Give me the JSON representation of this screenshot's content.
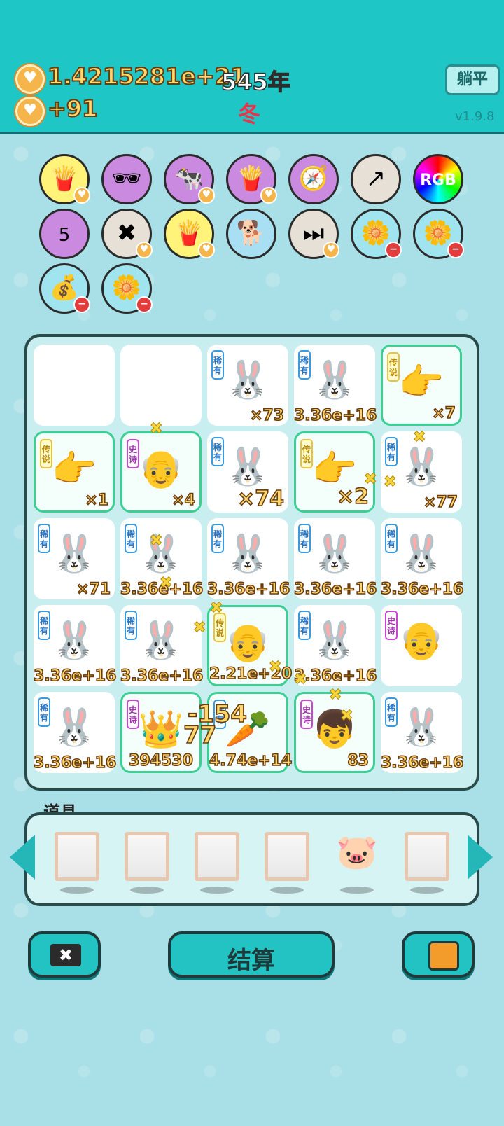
{
  "header": {
    "coins": "1.4215281e+21",
    "income": "+91",
    "year": "545年",
    "season": "冬",
    "lie_ping": "躺平",
    "version": "v1.9.8"
  },
  "buffs": [
    {
      "icon": "fries-icon",
      "glyph": "🍟",
      "bg": "yellow",
      "badge": "heart"
    },
    {
      "icon": "melon-sunglasses-icon",
      "glyph": "🕶",
      "bg": "purple",
      "badge": ""
    },
    {
      "icon": "cow-twins-icon",
      "glyph": "🐄",
      "bg": "purple",
      "badge": "heart"
    },
    {
      "icon": "fries-icon",
      "glyph": "🍟",
      "bg": "purple",
      "badge": "heart"
    },
    {
      "icon": "compass-icon",
      "glyph": "🧭",
      "bg": "purple",
      "badge": ""
    },
    {
      "icon": "chart-arrow-icon",
      "glyph": "↗",
      "bg": "grey",
      "badge": ""
    },
    {
      "icon": "rgb-icon",
      "glyph": "RGB",
      "bg": "rgb",
      "badge": ""
    },
    {
      "icon": "calendar-icon",
      "glyph": "5",
      "bg": "purple",
      "badge": ""
    },
    {
      "icon": "delete-tag-icon",
      "glyph": "✖",
      "bg": "grey",
      "badge": "heart"
    },
    {
      "icon": "fries-icon",
      "glyph": "🍟",
      "bg": "yellow",
      "badge": "heart"
    },
    {
      "icon": "shiba-dog-icon",
      "glyph": "🐕",
      "bg": "blue",
      "badge": ""
    },
    {
      "icon": "skip-icon",
      "glyph": "⏭",
      "bg": "grey",
      "badge": "heart"
    },
    {
      "icon": "flower-pot-icon",
      "glyph": "🌼",
      "bg": "cyan",
      "badge": "minus"
    },
    {
      "icon": "flower-pot-icon",
      "glyph": "🌼",
      "bg": "cyan",
      "badge": "minus"
    },
    {
      "icon": "money-bag-icon",
      "glyph": "💰",
      "bg": "cyan",
      "badge": "minus"
    },
    {
      "icon": "flower-pot-icon",
      "glyph": "🌼",
      "bg": "cyan",
      "badge": "minus"
    }
  ],
  "board": [
    {
      "kind": "empty"
    },
    {
      "kind": "empty"
    },
    {
      "kind": "rare",
      "label": "稀有",
      "sprite": "🐰",
      "count": "×73"
    },
    {
      "kind": "rare",
      "label": "稀有",
      "sprite": "🐰",
      "count": "3.36e+16"
    },
    {
      "kind": "legend",
      "label": "传说",
      "sprite": "👉",
      "count": "×7"
    },
    {
      "kind": "legend",
      "label": "传说",
      "sprite": "👉",
      "count": "×1"
    },
    {
      "kind": "epic",
      "label": "史诗",
      "sprite": "👴",
      "count": "×4"
    },
    {
      "kind": "rare",
      "label": "稀有",
      "sprite": "🐰",
      "count": "×74",
      "big": true
    },
    {
      "kind": "legend",
      "label": "传说",
      "sprite": "👉",
      "count": "×2",
      "big": true
    },
    {
      "kind": "rare",
      "label": "稀有",
      "sprite": "🐰",
      "count": "×77"
    },
    {
      "kind": "rare",
      "label": "稀有",
      "sprite": "🐰",
      "count": "×71"
    },
    {
      "kind": "rare",
      "label": "稀有",
      "sprite": "🐰",
      "count": "3.36e+16"
    },
    {
      "kind": "rare",
      "label": "稀有",
      "sprite": "🐰",
      "count": "3.36e+16"
    },
    {
      "kind": "rare",
      "label": "稀有",
      "sprite": "🐰",
      "count": "3.36e+16"
    },
    {
      "kind": "rare",
      "label": "稀有",
      "sprite": "🐰",
      "count": "3.36e+16"
    },
    {
      "kind": "rare",
      "label": "稀有",
      "sprite": "🐰",
      "count": "3.36e+16"
    },
    {
      "kind": "rare",
      "label": "稀有",
      "sprite": "🐰",
      "count": "3.36e+16"
    },
    {
      "kind": "epic",
      "label": "传说",
      "sprite": "👴",
      "count": "2.21e+20"
    },
    {
      "kind": "rare",
      "label": "稀有",
      "sprite": "🐰",
      "count": "3.36e+16"
    },
    {
      "kind": "epic_plain",
      "label": "史诗",
      "sprite": "👴",
      "count": ""
    },
    {
      "kind": "rare",
      "label": "稀有",
      "sprite": "🐰",
      "count": "3.36e+16"
    },
    {
      "kind": "epic",
      "label": "史诗",
      "sprite": "👑",
      "count": "394530"
    },
    {
      "kind": "epic",
      "label": "稀有",
      "sprite": "🥕",
      "count": "4.74e+14"
    },
    {
      "kind": "epic",
      "label": "史诗",
      "sprite": "👦",
      "count": "83"
    },
    {
      "kind": "rare",
      "label": "稀有",
      "sprite": "🐰",
      "count": "3.36e+16"
    }
  ],
  "floats": {
    "minus": "-154",
    "plus": "77"
  },
  "props": {
    "title": "道具",
    "slots": [
      "empty",
      "empty",
      "empty",
      "empty",
      "piggy-bank",
      "empty"
    ]
  },
  "buttons": {
    "settle": "结算"
  }
}
